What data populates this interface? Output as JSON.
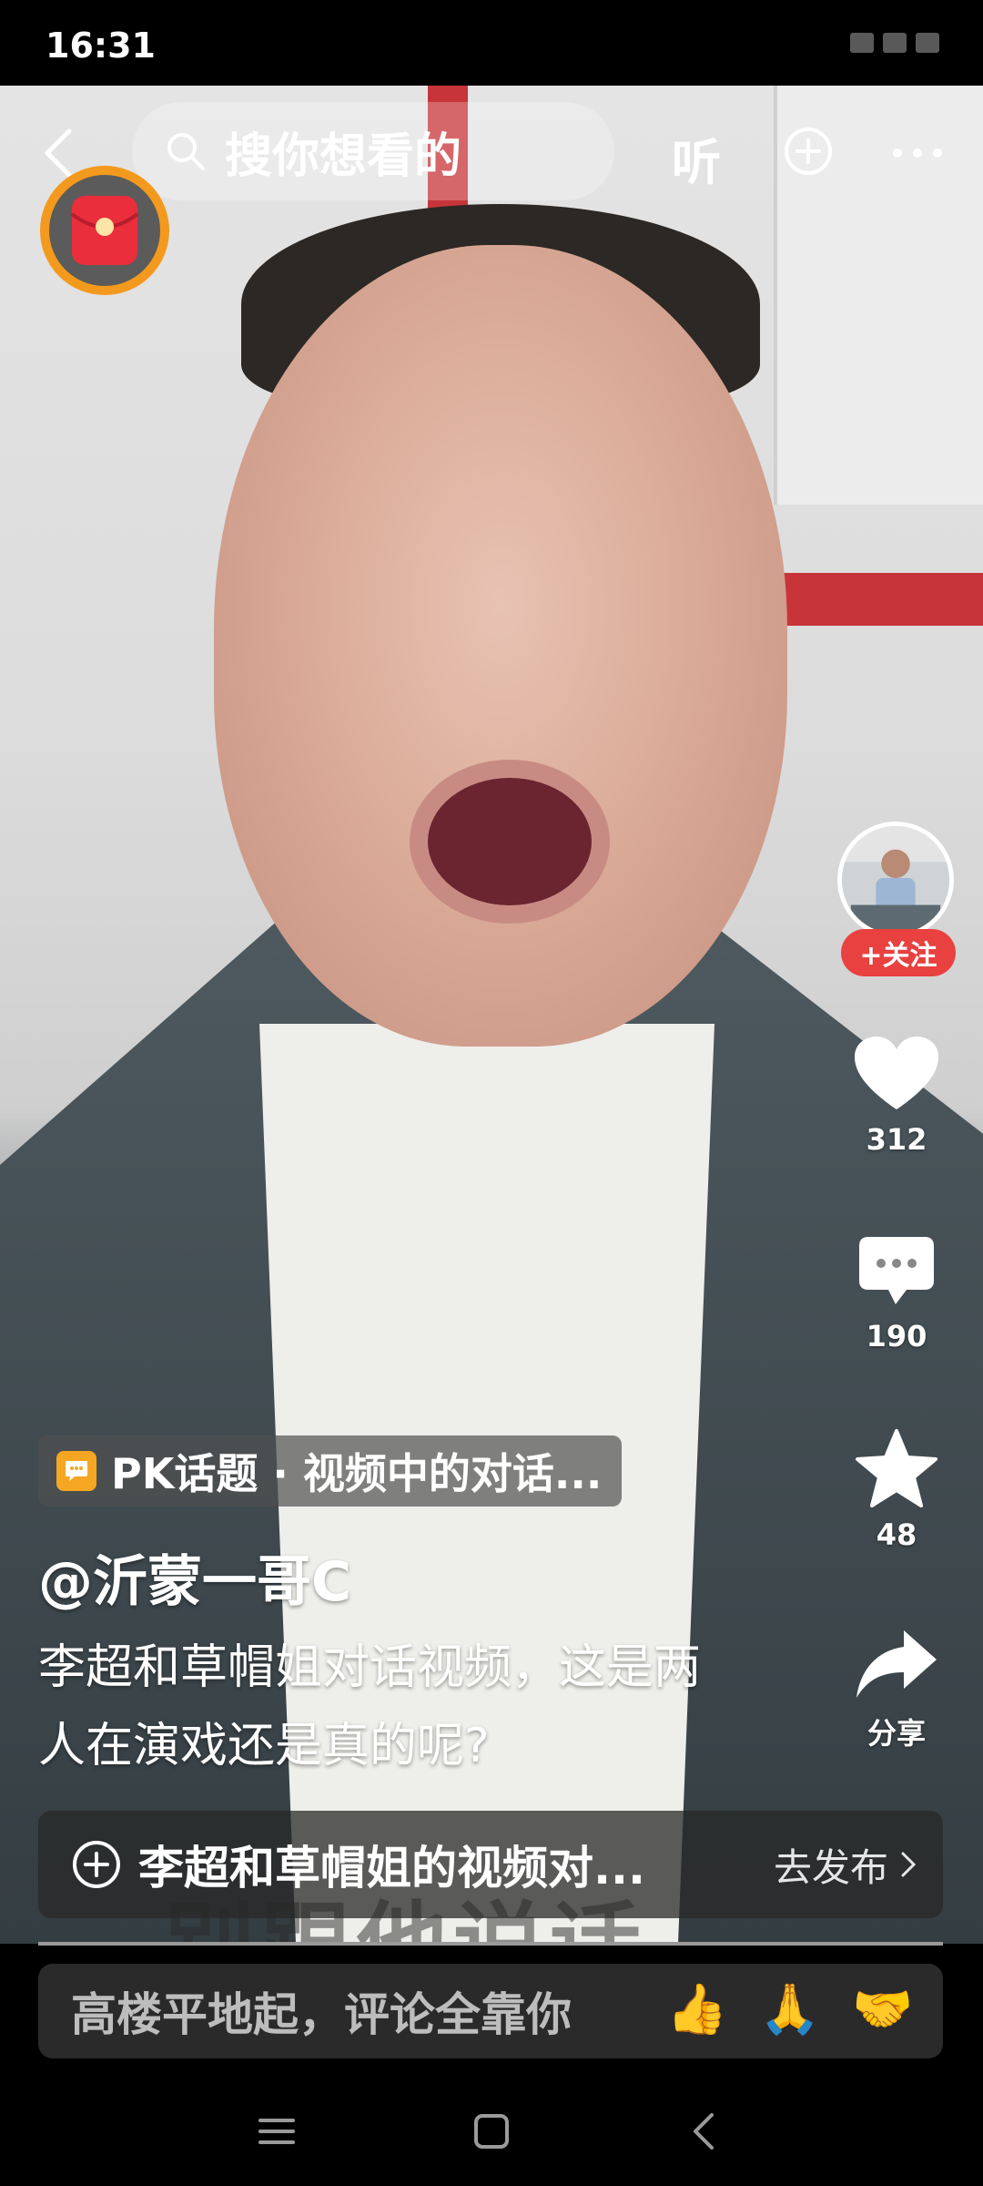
{
  "status_bar": {
    "time": "16:31"
  },
  "top_bar": {
    "search_placeholder": "搜你想看的",
    "listen_label": "听"
  },
  "rail": {
    "follow_label": "+关注",
    "likes": "312",
    "comments": "190",
    "favorites": "48",
    "share_label": "分享"
  },
  "info": {
    "pk_tag": "PK话题 · 视频中的对话...",
    "author": "@沂蒙一哥C",
    "description_line1": "李超和草帽姐对话视频，这是两",
    "description_line2": "人在演戏还是真的呢?"
  },
  "publish": {
    "topic": "李超和草帽姐的视频对...",
    "action": "去发布"
  },
  "comment": {
    "placeholder": "高楼平地起，评论全靠你",
    "emojis": [
      "👍",
      "🙏",
      "🤝"
    ]
  },
  "video": {
    "caption_text": "别跟他说话"
  },
  "colors": {
    "follow": "#e8413f",
    "redpacket_ring": "#f39a1e",
    "pk_icon": "#f5a623"
  }
}
